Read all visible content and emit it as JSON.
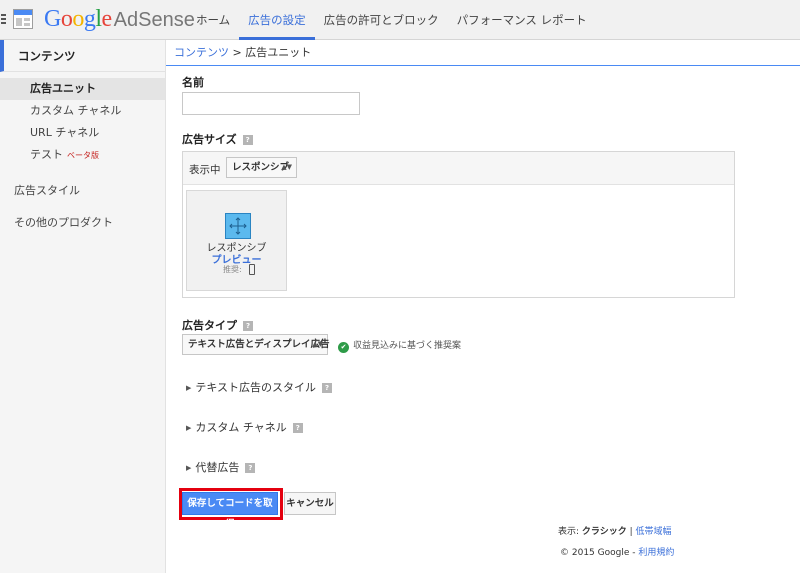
{
  "brand": {
    "google": [
      {
        "ch": "G",
        "color": "#3b7af3"
      },
      {
        "ch": "o",
        "color": "#e6443a"
      },
      {
        "ch": "o",
        "color": "#f4b400"
      },
      {
        "ch": "g",
        "color": "#3b7af3"
      },
      {
        "ch": "l",
        "color": "#24a045"
      },
      {
        "ch": "e",
        "color": "#e6443a"
      }
    ],
    "product": "AdSense"
  },
  "nav": {
    "items": [
      {
        "label": "ホーム",
        "active": false
      },
      {
        "label": "広告の設定",
        "active": true
      },
      {
        "label": "広告の許可とブロック",
        "active": false
      },
      {
        "label": "パフォーマンス レポート",
        "active": false
      }
    ]
  },
  "sidebar": {
    "header": "コンテンツ",
    "items": [
      "広告ユニット",
      "カスタム チャネル",
      "URL チャネル",
      "テスト"
    ],
    "beta": "ベータ版",
    "sections": [
      "広告スタイル",
      "その他のプロダクト"
    ]
  },
  "breadcrumb": {
    "link": "コンテンツ",
    "separator": " > ",
    "current": "広告ユニット"
  },
  "form": {
    "name_label": "名前",
    "name_value": "",
    "size_label": "広告サイズ",
    "showing_label": "表示中",
    "size_select": "レスポンシブ",
    "card_title": "レスポンシブ",
    "card_link": "プレビュー",
    "card_recommended": "推奨:",
    "type_label": "広告タイプ",
    "type_select": "テキスト広告とディスプレイ広告",
    "type_note": "収益見込みに基づく推奨案",
    "sections": [
      "テキスト広告のスタイル",
      "カスタム チャネル",
      "代替広告"
    ],
    "help_glyph": "?",
    "arrow_glyph": "▲▼"
  },
  "buttons": {
    "save": "保存してコードを取得",
    "cancel": "キャンセル"
  },
  "footer": {
    "view_prefix": "表示:",
    "view_current": "クラシック",
    "separator": "|",
    "view_alt": "低帯域幅",
    "copyright": "© 2015 Google",
    "dash": " - ",
    "terms": "利用規約"
  },
  "colors": {
    "accent": "#3a6fd9",
    "primary_button": "#4a8af4",
    "highlight_border": "#e4000f",
    "check_green": "#2e9b48"
  }
}
